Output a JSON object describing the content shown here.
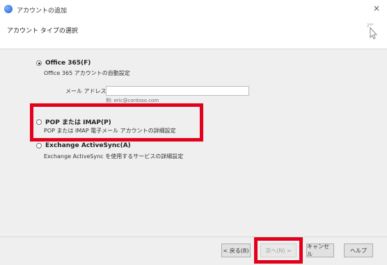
{
  "window": {
    "title": "アカウントの追加",
    "close_glyph": "×"
  },
  "header": {
    "title": "アカウント タイプの選択"
  },
  "options": [
    {
      "label": "Office 365(F)",
      "description": "Office 365 アカウントの自動設定",
      "selected": true
    },
    {
      "label": "POP または IMAP(P)",
      "description": "POP または IMAP 電子メール アカウントの詳細設定",
      "selected": false
    },
    {
      "label": "Exchange ActiveSync(A)",
      "description": "Exchange ActiveSync を使用するサービスの詳細設定",
      "selected": false
    }
  ],
  "email": {
    "label": "メール アドレス(E):",
    "value": "",
    "hint": "例: eric@contoso.com"
  },
  "buttons": {
    "back": "< 戻る(B)",
    "next": "次へ(N) >",
    "cancel": "キャンセル",
    "help": "ヘルプ"
  },
  "highlight_color": "#e3001b"
}
